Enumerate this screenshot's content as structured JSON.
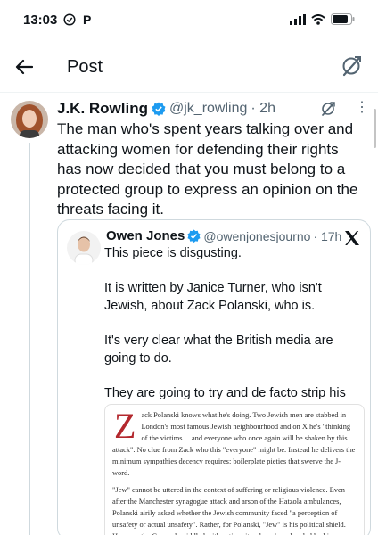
{
  "status": {
    "time": "13:03",
    "carrier_letter": "P"
  },
  "header": {
    "title": "Post"
  },
  "tweet": {
    "author_name": "J.K. Rowling",
    "handle": "@jk_rowling",
    "time": "· 2h",
    "text": "The man who's spent years talking over and attacking women for defending their rights has now decided that you must belong to a protected group to express an opinion on the threats facing it."
  },
  "quote": {
    "author_name": "Owen Jones",
    "handle": "@owenjonesjourno",
    "time": "· 17h",
    "paragraphs": [
      "This piece is disgusting.",
      "It is written by Janice Turner, who isn't Jewish, about Zack Polanski, who is.",
      "It's very clear what the British media are going to do.",
      "They are going to try and de facto strip his Jewish identity away from him."
    ],
    "article": {
      "dropcap": "Z",
      "p1": "ack Polanski knows what he's doing. Two Jewish men are stabbed in London's most famous Jewish neighbourhood and on X he's \"thinking of the victims ... and everyone who once again will be shaken by this attack\". No clue from Zack who this \"everyone\" might be. Instead he delivers the minimum sympathies decency requires: boilerplate pieties that swerve the J-word.",
      "p2": "\"Jew\" cannot be uttered in the context of suffering or religious violence. Even after the Manchester synagogue attack and arson of the Hatzola ambulances, Polanski airily asked whether the Jewish community faced \"a perception of unsafety or actual unsafety\". Rather, for Polanski, \"Jew\" is his political shield. How can the Greens be riddled with antisemites, he asks, when led by him, a Jew?"
    }
  },
  "colors": {
    "verified": "#1d9bf0",
    "dropcap": "#b3282e",
    "line": "#cfd9de"
  },
  "icons": [
    "back-arrow-icon",
    "grok-icon",
    "verified-badge-icon",
    "more-icon",
    "x-logo-icon",
    "wifi-icon",
    "signal-icon",
    "battery-icon"
  ]
}
